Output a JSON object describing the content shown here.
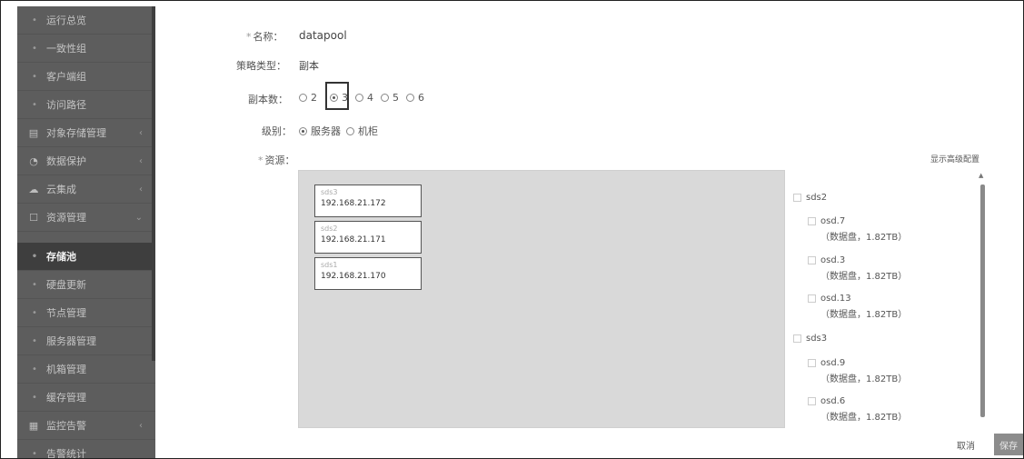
{
  "sidebar": {
    "items": [
      {
        "label": "运行总览",
        "icon": "dot"
      },
      {
        "label": "一致性组",
        "icon": "dot"
      },
      {
        "label": "客户端组",
        "icon": "dot"
      },
      {
        "label": "访问路径",
        "icon": "dot"
      },
      {
        "label": "对象存储管理",
        "icon": "bucket-icon",
        "arrow": "‹"
      },
      {
        "label": "数据保护",
        "icon": "shield-icon",
        "arrow": "‹"
      },
      {
        "label": "云集成",
        "icon": "cloud-icon",
        "arrow": "‹"
      },
      {
        "label": "资源管理",
        "icon": "resource-icon",
        "arrow": "⌄"
      },
      {
        "label": "存储池",
        "icon": "dot",
        "active": true
      },
      {
        "label": "硬盘更新",
        "icon": "dot"
      },
      {
        "label": "节点管理",
        "icon": "dot"
      },
      {
        "label": "服务器管理",
        "icon": "dot"
      },
      {
        "label": "机箱管理",
        "icon": "dot"
      },
      {
        "label": "缓存管理",
        "icon": "dot"
      },
      {
        "label": "监控告警",
        "icon": "monitor-icon",
        "arrow": "‹"
      },
      {
        "label": "告警统计",
        "icon": "dot"
      }
    ]
  },
  "form": {
    "name_label": "名称：",
    "name_value": "datapool",
    "policy_label": "策略类型：",
    "policy_value": "副本",
    "replica_label": "副本数：",
    "replica_options": [
      "2",
      "3",
      "4",
      "5",
      "6"
    ],
    "replica_selected": "3",
    "level_label": "级别：",
    "level_options": [
      "服务器",
      "机柜"
    ],
    "level_selected": "服务器",
    "resource_label": "资源：",
    "advanced_link": "显示高级配置"
  },
  "nodes": [
    {
      "name": "sds3",
      "ip": "192.168.21.172"
    },
    {
      "name": "sds2",
      "ip": "192.168.21.171"
    },
    {
      "name": "sds1",
      "ip": "192.168.21.170"
    }
  ],
  "tree": [
    {
      "host": "sds2",
      "osds": [
        {
          "name": "osd.7",
          "detail": "（数据盘，1.82TB）"
        },
        {
          "name": "osd.3",
          "detail": "（数据盘，1.82TB）"
        },
        {
          "name": "osd.13",
          "detail": "（数据盘，1.82TB）"
        }
      ]
    },
    {
      "host": "sds3",
      "osds": [
        {
          "name": "osd.9",
          "detail": "（数据盘，1.82TB）"
        },
        {
          "name": "osd.6",
          "detail": "（数据盘，1.82TB）"
        }
      ]
    }
  ],
  "actions": {
    "cancel": "取消",
    "save": "保存"
  }
}
